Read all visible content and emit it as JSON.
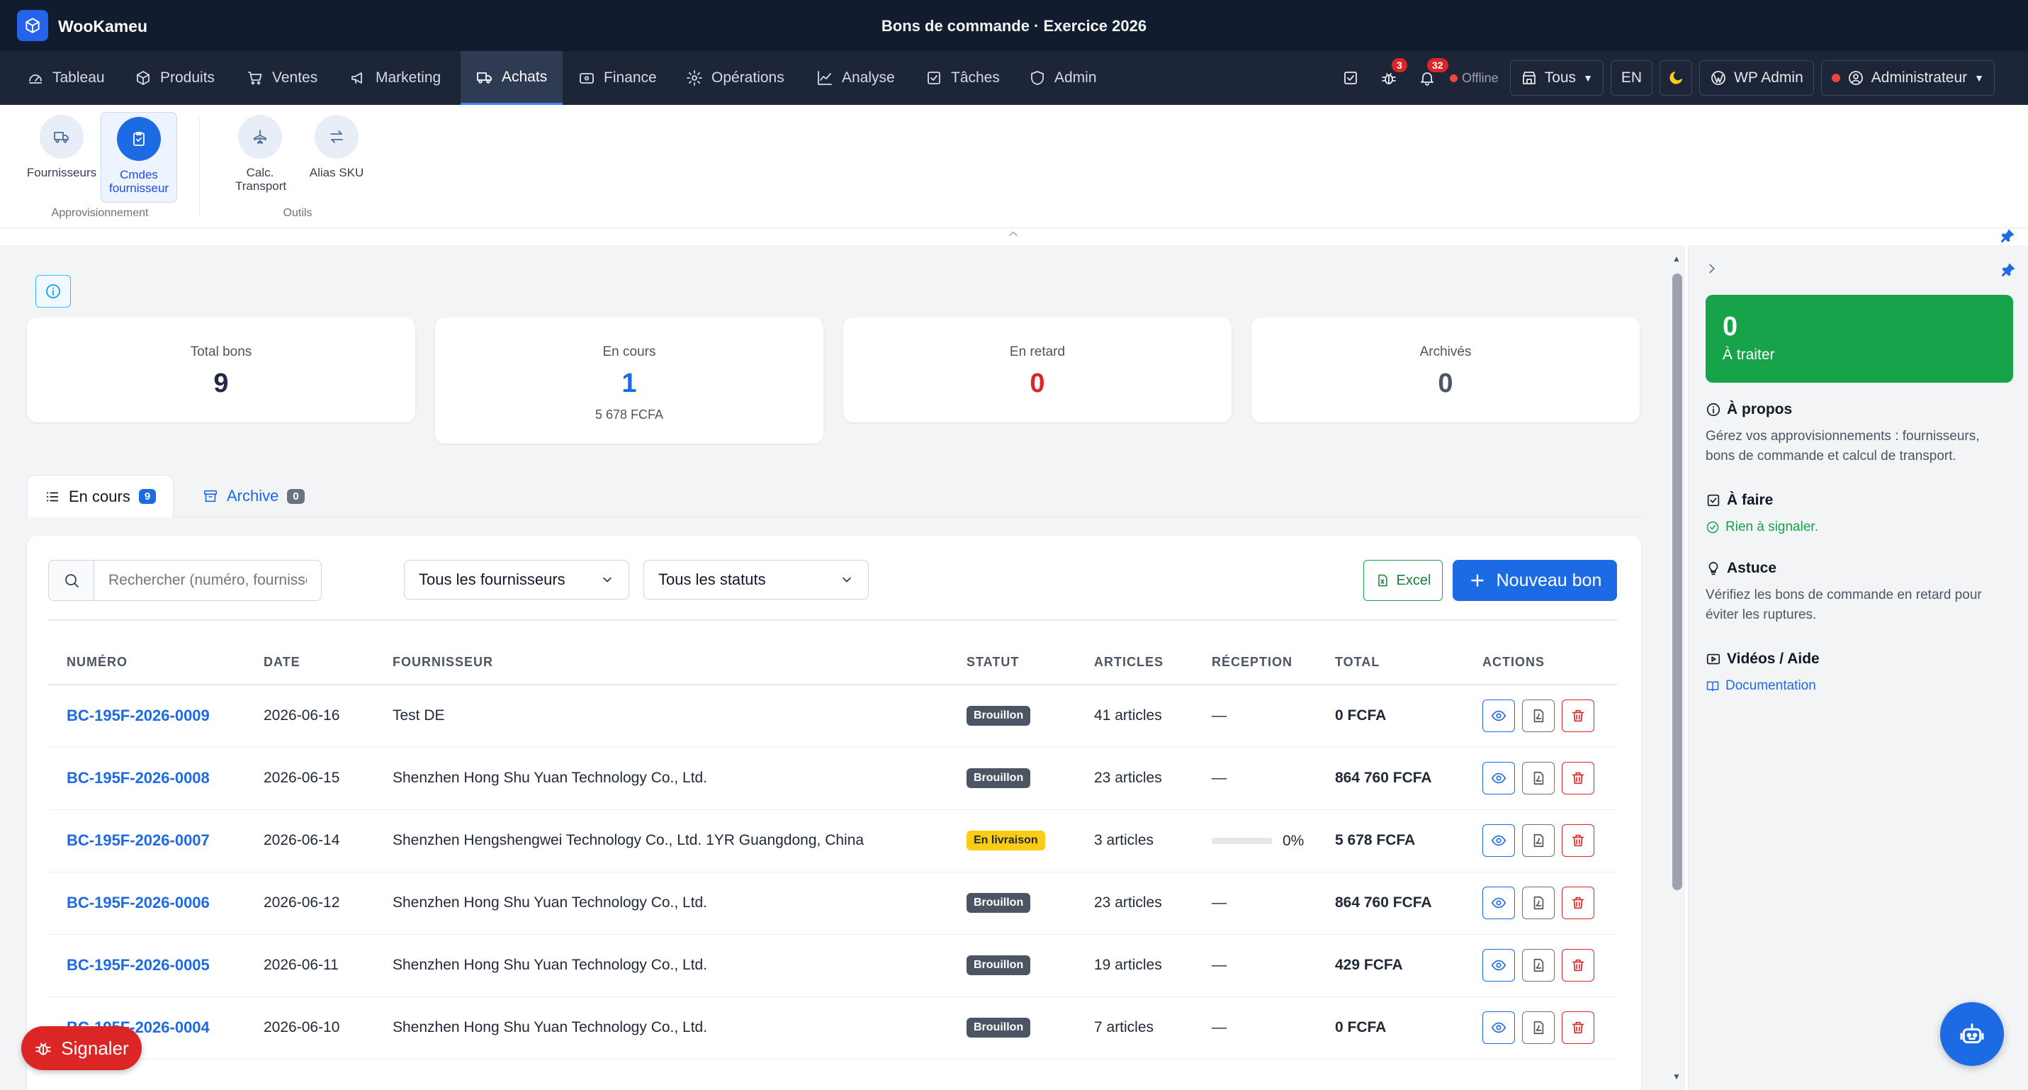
{
  "app": {
    "name": "WooKameu",
    "window_title": "Bons de commande · Exercice 2026"
  },
  "nav": {
    "items": [
      {
        "label": "Tableau",
        "icon": "gauge-icon"
      },
      {
        "label": "Produits",
        "icon": "box-icon"
      },
      {
        "label": "Ventes",
        "icon": "cart-icon"
      },
      {
        "label": "Marketing",
        "icon": "megaphone-icon"
      },
      {
        "label": "Achats",
        "icon": "truck-icon",
        "active": true
      },
      {
        "label": "Finance",
        "icon": "wallet-icon"
      },
      {
        "label": "Opérations",
        "icon": "gear-icon"
      },
      {
        "label": "Analyse",
        "icon": "chart-icon"
      },
      {
        "label": "Tâches",
        "icon": "check-square-icon"
      },
      {
        "label": "Admin",
        "icon": "shield-icon"
      }
    ],
    "bug_badge": "3",
    "bell_badge": "32",
    "offline_label": "Offline",
    "store_select": "Tous",
    "lang": "EN",
    "wp_admin": "WP Admin",
    "user": "Administrateur"
  },
  "ribbon": {
    "items": [
      {
        "label": "Fournisseurs"
      },
      {
        "label": "Cmdes fournisseur",
        "active": true
      },
      {
        "label": "Calc. Transport"
      },
      {
        "label": "Alias SKU"
      }
    ],
    "groups": [
      "Approvisionnement",
      "Outils"
    ]
  },
  "stats": [
    {
      "label": "Total bons",
      "value": "9",
      "sub": "",
      "color": "#1f2a44"
    },
    {
      "label": "En cours",
      "value": "1",
      "sub": "5 678 FCFA",
      "color": "#1d6ae5"
    },
    {
      "label": "En retard",
      "value": "0",
      "sub": "",
      "color": "#dc2626"
    },
    {
      "label": "Archivés",
      "value": "0",
      "sub": "",
      "color": "#4b5563"
    }
  ],
  "tabs": [
    {
      "label": "En cours",
      "count": "9"
    },
    {
      "label": "Archive",
      "count": "0"
    }
  ],
  "toolbar": {
    "search_placeholder": "Rechercher (numéro, fournisseur...)",
    "supplier_filter": "Tous les fournisseurs",
    "status_filter": "Tous les statuts",
    "excel": "Excel",
    "new_button": "Nouveau bon"
  },
  "table": {
    "headers": [
      "NUMÉRO",
      "DATE",
      "FOURNISSEUR",
      "STATUT",
      "ARTICLES",
      "RÉCEPTION",
      "TOTAL",
      "ACTIONS"
    ],
    "rows": [
      {
        "num": "BC-195F-2026-0009",
        "date": "2026-06-16",
        "supplier": "Test DE",
        "status": "Brouillon",
        "articles": "41 articles",
        "reception": "—",
        "total": "0 FCFA"
      },
      {
        "num": "BC-195F-2026-0008",
        "date": "2026-06-15",
        "supplier": "Shenzhen Hong Shu Yuan Technology Co., Ltd.",
        "status": "Brouillon",
        "articles": "23 articles",
        "reception": "—",
        "total": "864 760 FCFA"
      },
      {
        "num": "BC-195F-2026-0007",
        "date": "2026-06-14",
        "supplier": "Shenzhen Hengshengwei Technology Co., Ltd. 1YR Guangdong, China",
        "status": "En livraison",
        "articles": "3 articles",
        "reception": "0%",
        "reception_progress": 0,
        "total": "5 678 FCFA"
      },
      {
        "num": "BC-195F-2026-0006",
        "date": "2026-06-12",
        "supplier": "Shenzhen Hong Shu Yuan Technology Co., Ltd.",
        "status": "Brouillon",
        "articles": "23 articles",
        "reception": "—",
        "total": "864 760 FCFA"
      },
      {
        "num": "BC-195F-2026-0005",
        "date": "2026-06-11",
        "supplier": "Shenzhen Hong Shu Yuan Technology Co., Ltd.",
        "status": "Brouillon",
        "articles": "19 articles",
        "reception": "—",
        "total": "429 FCFA"
      },
      {
        "num": "BC-195F-2026-0004",
        "date": "2026-06-10",
        "supplier": "Shenzhen Hong Shu Yuan Technology Co., Ltd.",
        "status": "Brouillon",
        "articles": "7 articles",
        "reception": "—",
        "total": "0 FCFA"
      }
    ]
  },
  "right_panel": {
    "todo_count": "0",
    "todo_label": "À traiter",
    "about_title": "À propos",
    "about_text": "Gérez vos approvisionnements : fournisseurs, bons de commande et calcul de transport.",
    "todo_title": "À faire",
    "todo_text": "Rien à signaler.",
    "tip_title": "Astuce",
    "tip_text": "Vérifiez les bons de commande en retard pour éviter les ruptures.",
    "video_title": "Vidéos / Aide",
    "doc_link": "Documentation"
  },
  "signaler": "Signaler",
  "colors": {
    "primary": "#1d6ae5",
    "success": "#16a34a",
    "danger": "#dc2626",
    "warning": "#facc15",
    "draft": "#4b5563"
  }
}
